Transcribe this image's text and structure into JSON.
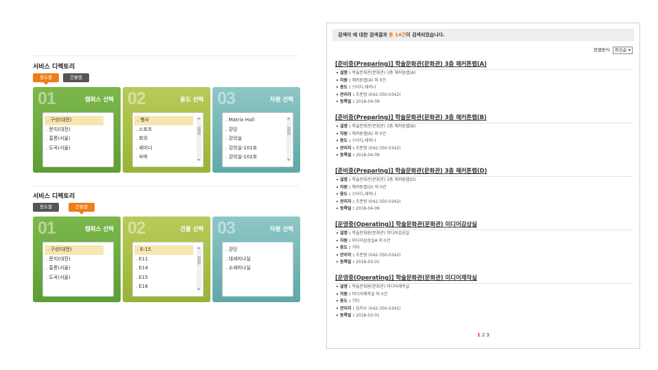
{
  "directory1": {
    "title": "서비스 디렉토리",
    "tabs": [
      "용도별",
      "건물별"
    ],
    "active_tab": 0,
    "panels": [
      {
        "num": "01",
        "title": "캠퍼스 선택",
        "items": [
          "구성(대전)",
          "문지(대전)",
          "홍릉(서울)",
          "도곡(서울)"
        ],
        "selected": 0
      },
      {
        "num": "02",
        "title": "용도 선택",
        "items": [
          "행사",
          "스포츠",
          "회의",
          "세미나",
          "숙박"
        ],
        "selected": 0
      },
      {
        "num": "03",
        "title": "자원 선택",
        "items": [
          "Matrix Hall",
          "강당",
          "강의실",
          "강의실-101호",
          "강의실-102호"
        ],
        "selected": -1
      }
    ]
  },
  "directory2": {
    "title": "서비스 디렉토리",
    "tabs": [
      "용도별",
      "건물별"
    ],
    "active_tab": 1,
    "panels": [
      {
        "num": "01",
        "title": "캠퍼스 선택",
        "items": [
          "구성(대전)",
          "문지(대전)",
          "홍릉(서울)",
          "도곡(서울)"
        ],
        "selected": 0
      },
      {
        "num": "02",
        "title": "건물 선택",
        "items": [
          "E-15",
          "E11",
          "E14",
          "E15",
          "E16"
        ],
        "selected": 0
      },
      {
        "num": "03",
        "title": "자원 선택",
        "items": [
          "강당",
          "대세미나실",
          "소세미나실"
        ],
        "selected": -1
      }
    ]
  },
  "results": {
    "summary_prefix": "검색어 에 대한 검색결과 ",
    "summary_count": "총 14건",
    "summary_suffix": "이 검색되었습니다.",
    "sort_label": "정렬방식",
    "sort_value": "최신순 ▾",
    "field_labels": {
      "desc": "설명 :",
      "resource": "자원 :",
      "usage": "용도 :",
      "manager": "관리자 :",
      "date": "등록일 :"
    },
    "items": [
      {
        "title": "[준비중(Preparing)] 학술문화관(문화관) 3층 해커톤랩(A)",
        "desc": "학술문화관(문화관) 3층 해커톤랩(A)",
        "resource": "해커톤랩(A) 외 0건",
        "usage": "스터디,세미나",
        "manager": "조준형 (042-350-0342)",
        "date": "2018-04-09"
      },
      {
        "title": "[준비중(Preparing)] 학술문화관(문화관) 3층 해커톤랩(B)",
        "desc": "학술문화관(문화관) 3층 해커톤랩(B)",
        "resource": "해커톤랩(B) 외 0건",
        "usage": "스터디,세미나",
        "manager": "조준형 (042-350-0342)",
        "date": "2018-04-09"
      },
      {
        "title": "[준비중(Preparing)] 학술문화관(문화관) 3층 해커톤랩(D)",
        "desc": "학술문화관(문화관) 3층 해커톤랩(D)",
        "resource": "해커톤랩(D) 외 0건",
        "usage": "스터디,세미나",
        "manager": "조준형 (042-350-0342)",
        "date": "2018-04-09"
      },
      {
        "title": "[운영중(Operating)] 학술문화관(문화관) 미디어감상실",
        "desc": "학술문화원(문화관) 미디어감상실",
        "resource": "미디어감상실A 외 0건",
        "usage": "기타",
        "manager": "조준형 (042-350-0342)",
        "date": "2018-03-01"
      },
      {
        "title": "[운영중(Operating)] 학술문화관(문화관) 미디어제작실",
        "desc": "학술문화원(문화관) 미디어제작실",
        "resource": "미디어제작실 외 0건",
        "usage": "기타",
        "manager": "임지수 (042-350-0341)",
        "date": "2018-03-01"
      }
    ],
    "pages": [
      "1",
      "2",
      "3"
    ],
    "current_page": "1"
  }
}
